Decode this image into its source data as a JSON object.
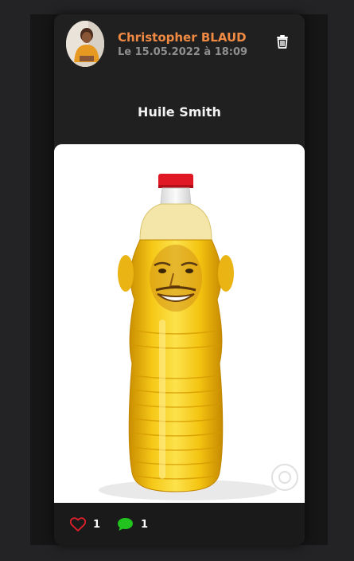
{
  "post": {
    "author": "Christopher BLAUD",
    "date": "Le 15.05.2022 à 18:09",
    "title": "Huile Smith",
    "likes": "1",
    "comments": "1"
  },
  "icons": {
    "delete": "trash-icon",
    "like": "heart-outline-icon",
    "comment": "speech-bubble-icon"
  },
  "colors": {
    "author": "#f08a43",
    "date": "#8f8f8f",
    "like": "#e0202b",
    "comment": "#22c31f",
    "card": "#202021"
  }
}
